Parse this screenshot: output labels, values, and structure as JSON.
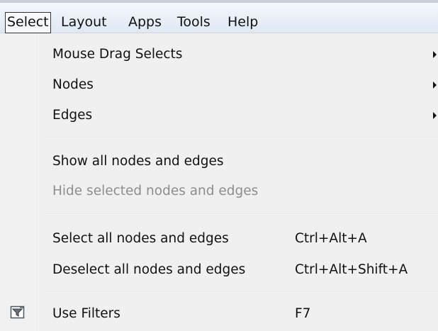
{
  "menubar": {
    "items": [
      {
        "label": "Select",
        "open": true
      },
      {
        "label": "Layout"
      },
      {
        "label": "Apps"
      },
      {
        "label": "Tools"
      },
      {
        "label": "Help"
      }
    ]
  },
  "menu": {
    "items": [
      {
        "label": "Mouse Drag Selects",
        "submenu": true,
        "enabled": true
      },
      {
        "label": "Nodes",
        "submenu": true,
        "enabled": true
      },
      {
        "label": "Edges",
        "submenu": true,
        "enabled": true
      },
      {
        "label": "Show all nodes and edges",
        "enabled": true
      },
      {
        "label": "Hide selected nodes and edges",
        "enabled": false
      },
      {
        "label": "Select all nodes and edges",
        "shortcut": "Ctrl+Alt+A",
        "enabled": true
      },
      {
        "label": "Deselect all nodes and edges",
        "shortcut": "Ctrl+Alt+Shift+A",
        "enabled": true
      },
      {
        "label": "Use Filters",
        "shortcut": "F7",
        "enabled": true,
        "icon": "filter-icon"
      }
    ]
  },
  "colors": {
    "menubar_top": "#f4f7fb",
    "menubar_bottom": "#dfe8f4",
    "menu_background": "#f0f0f0",
    "text": "#111111",
    "disabled_text": "#8d8d8d"
  }
}
